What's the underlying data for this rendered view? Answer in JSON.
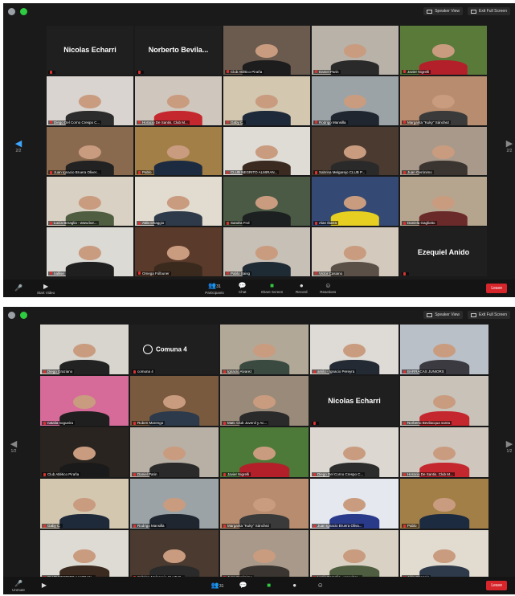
{
  "window1": {
    "top_buttons": [
      "Speaker View",
      "Exit Full Screen"
    ],
    "page_left": "2/2",
    "page_right": "2/2",
    "toolbar": {
      "unmute": "",
      "start_video": "Start Video",
      "participants": "Participants",
      "participants_count": "31",
      "chat": "Chat",
      "share": "Share Screen",
      "record": "Record",
      "reactions": "Reactions",
      "leave": "Leave"
    },
    "tiles": [
      {
        "name": "",
        "big": "Nicolas Echarri",
        "video": false
      },
      {
        "name": "",
        "big": "Norberto  Bevila...",
        "video": false
      },
      {
        "name": "Club Atlético Piraña",
        "bg": "#6b5a4e",
        "shirt": "#1d1d1d",
        "video": true
      },
      {
        "name": "Daniel Parin",
        "bg": "#b9b2a8",
        "shirt": "#2a2a2a",
        "video": true
      },
      {
        "name": "Javier Nigrelli",
        "bg": "#5a7a3a",
        "shirt": "#b3202a",
        "video": true
      },
      {
        "name": "Diego Del Corno Crespo C...",
        "bg": "#d9d4cf",
        "shirt": "#2c2c2c",
        "video": true
      },
      {
        "name": "Horacio De Santis. Club M...",
        "bg": "#cfc7bd",
        "shirt": "#c4282e",
        "video": true
      },
      {
        "name": "Gaby C.",
        "bg": "#d3c7b0",
        "shirt": "#1e2a3a",
        "video": true
      },
      {
        "name": "Rodrigo Mansilla",
        "bg": "#9ba3a7",
        "shirt": "#1f2630",
        "video": true
      },
      {
        "name": "Margarita \"Kuky\" Sánchez",
        "bg": "#b88c6e",
        "shirt": "#3a3a3a",
        "video": true
      },
      {
        "name": "Juan Ignacio Bruera Oliver...",
        "bg": "#8a6a4e",
        "shirt": "#222222",
        "video": true
      },
      {
        "name": "Pablo",
        "bg": "#a37f48",
        "shirt": "#1c2b40",
        "video": true
      },
      {
        "name": "CLUB NEGRITO ALMIRAN...",
        "bg": "#dfdcd6",
        "shirt": "#3a2a20",
        "video": true
      },
      {
        "name": "Sabrina Melgarejo CLUB P...",
        "bg": "#4a3a30",
        "shirt": "#2a2a2a",
        "video": true
      },
      {
        "name": "Juan Gerónimo",
        "bg": "#a8998a",
        "shirt": "#3a3530",
        "video": true
      },
      {
        "name": "Lucía Beraglia - www.bor...",
        "bg": "#d9d1c3",
        "shirt": "#4f5d40",
        "video": true
      },
      {
        "name": "Aldo Ohaggio",
        "bg": "#e2dbd0",
        "shirt": "#2e3a4a",
        "video": true
      },
      {
        "name": "Sandra Frol",
        "bg": "#4a5a44",
        "shirt": "#1d2020",
        "video": true
      },
      {
        "name": "Alan Ibarra",
        "bg": "#344a74",
        "shirt": "#e6cf20",
        "video": true
      },
      {
        "name": "Daniela Gagliotto",
        "bg": "#b5a58e",
        "shirt": "#6b2a2a",
        "video": true
      },
      {
        "name": "nallise",
        "bg": "#dcdad5",
        "shirt": "#1f1f1f",
        "video": true
      },
      {
        "name": "Omega Fúlbuner",
        "bg": "#5a3a2a",
        "shirt": "#3a2a1e",
        "video": true
      },
      {
        "name": "Pablo Saisg",
        "bg": "#c7c0b6",
        "shirt": "#1e2a34",
        "video": true
      },
      {
        "name": "Victor Casiano",
        "bg": "#d3cabd",
        "shirt": "#5a5048",
        "video": true
      },
      {
        "name": "",
        "big": "Ezequiel Anido",
        "video": false
      }
    ]
  },
  "window2": {
    "top_buttons": [
      "Speaker View",
      "Exit Full Screen"
    ],
    "page_left": "1/2",
    "page_right": "1/2",
    "toolbar": {
      "unmute": "Unmute",
      "start_video": "",
      "participants": "",
      "participants_count": "31",
      "chat": "",
      "share": "",
      "record": "",
      "reactions": "",
      "leave": "Leave"
    },
    "tiles": [
      {
        "name": "Diego Graziano",
        "bg": "#d8d4ce",
        "shirt": "#222222",
        "video": true,
        "active": true
      },
      {
        "name": "comuna 4",
        "logo": "Comuna 4",
        "video": false
      },
      {
        "name": "Ignacio Alvarez",
        "bg": "#b2a898",
        "shirt": "#3a4a40",
        "video": true
      },
      {
        "name": "amilo - Ignacio Pereyra",
        "bg": "#dedbd6",
        "shirt": "#232a33",
        "video": true
      },
      {
        "name": "BARRACAS JUNIORS",
        "bg": "#b9c0c8",
        "shirt": "#3a3a40",
        "video": true
      },
      {
        "name": "natalia nogueira",
        "bg": "#d66b9a",
        "shirt": "#1f1f1f",
        "video": true
      },
      {
        "name": "Ruben Marengo",
        "bg": "#7a5a3e",
        "shirt": "#2c3a4c",
        "video": true
      },
      {
        "name": "Matt. Club Juvenil y Ac...",
        "bg": "#9a8a7a",
        "shirt": "#2a2a2a",
        "video": true
      },
      {
        "name": "",
        "big": "Nicolas Echarri",
        "video": false
      },
      {
        "name": "Norberto Bevilacqua santa",
        "bg": "#c8c2b9",
        "shirt": "#c4282e",
        "video": true
      },
      {
        "name": "Club Atlético Piraña",
        "bg": "#2a2420",
        "shirt": "#1a1a1a",
        "video": true
      },
      {
        "name": "Daniel Parin",
        "bg": "#b8b0a4",
        "shirt": "#2a2a2a",
        "video": true
      },
      {
        "name": "Javier Nigrelli",
        "bg": "#4d7a38",
        "shirt": "#b3202a",
        "video": true
      },
      {
        "name": "Diego Del Corno Crespo C...",
        "bg": "#dcd7d0",
        "shirt": "#2c2c2c",
        "video": true
      },
      {
        "name": "Horacio De Santis. Club M...",
        "bg": "#cfc7bd",
        "shirt": "#c4282e",
        "video": true
      },
      {
        "name": "Gaby C.",
        "bg": "#d3c7b0",
        "shirt": "#1e2a3a",
        "video": true
      },
      {
        "name": "Rodrigo Mansilla",
        "bg": "#9ba3a7",
        "shirt": "#1f2630",
        "video": true
      },
      {
        "name": "Margarita \"Kuky\" Sánchez",
        "bg": "#b88c6e",
        "shirt": "#3a3a3a",
        "video": true
      },
      {
        "name": "Juan Ignacio Bruera Oliva...",
        "bg": "#e5e8ef",
        "shirt": "#2a3a8a",
        "video": true
      },
      {
        "name": "Pablo",
        "bg": "#a37f48",
        "shirt": "#1c2b40",
        "video": true
      },
      {
        "name": "CLUB NEGRITO ALMIRAN...",
        "bg": "#dedbd4",
        "shirt": "#3a2a20",
        "video": true
      },
      {
        "name": "Sabrina Melgarejo CLUB P...",
        "bg": "#4a3a30",
        "shirt": "#2a2a2a",
        "video": true
      },
      {
        "name": "Juan Gerónimo",
        "bg": "#a8998a",
        "shirt": "#3a3530",
        "video": true
      },
      {
        "name": "Lucía Beraglia - www.bor...",
        "bg": "#d9d1c3",
        "shirt": "#4f5d40",
        "video": true
      },
      {
        "name": "Aldo Ohaggio",
        "bg": "#e2dbd0",
        "shirt": "#2e3a4a",
        "video": true
      }
    ]
  }
}
